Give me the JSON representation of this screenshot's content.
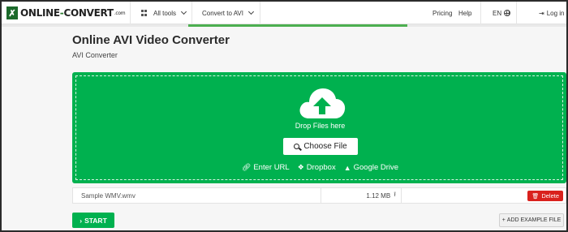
{
  "header": {
    "logo": {
      "prefix": "ONLINE",
      "dash": "-",
      "suffix": "CONVERT",
      "com": ".com"
    },
    "all_tools": "All tools",
    "convert_to": "Convert to AVI",
    "pricing": "Pricing",
    "help": "Help",
    "lang": "EN",
    "login": "Log in"
  },
  "page": {
    "title": "Online AVI Video Converter",
    "subtitle": "AVI Converter"
  },
  "dropzone": {
    "drop_text": "Drop Files here",
    "choose_label": "Choose File",
    "sources": [
      {
        "icon": "link-icon",
        "label": "Enter URL"
      },
      {
        "icon": "dropbox-icon",
        "label": "Dropbox"
      },
      {
        "icon": "google-drive-icon",
        "label": "Google Drive"
      }
    ]
  },
  "file": {
    "name": "Sample WMV.wmv",
    "size": "1.12 MB",
    "delete_label": "Delete"
  },
  "actions": {
    "start_label": "START",
    "add_example_label": "ADD EXAMPLE FILE"
  },
  "colors": {
    "brand_green": "#00b14f",
    "delete_red": "#d9211d"
  }
}
